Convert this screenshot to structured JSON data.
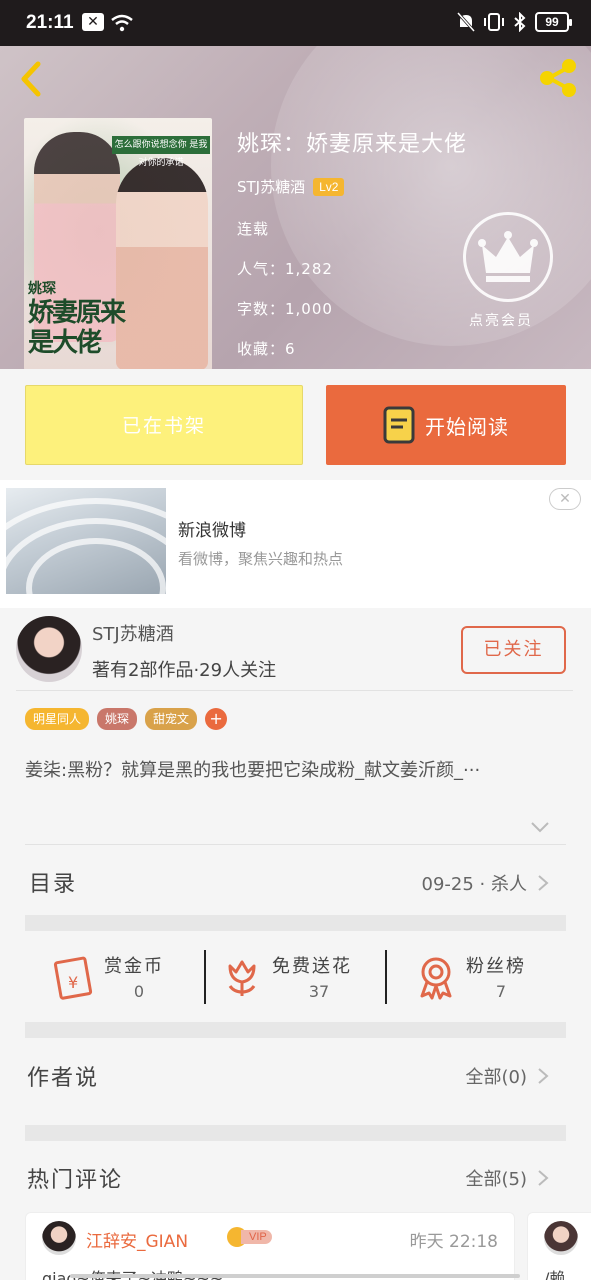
{
  "status_bar": {
    "time": "21:11",
    "battery": "99"
  },
  "book": {
    "title": "姚琛：娇妻原来是大佬",
    "author": "STJ苏糖酒",
    "level": "Lv2",
    "status": "连载",
    "popularity": "人气：1,282",
    "word_count": "字数：1,000",
    "favorites": "收藏：6",
    "vip_label": "点亮会员"
  },
  "cover": {
    "tag": "怎么跟你说想念你 是我对你的承诺",
    "title": "娇妻原来是大佬",
    "subtitle": "姚琛"
  },
  "actions": {
    "shelf": "已在书架",
    "read": "开始阅读"
  },
  "ad": {
    "title": "新浪微博",
    "subtitle": "看微博，聚焦兴趣和热点",
    "close": "✕"
  },
  "author": {
    "name": "STJ苏糖酒",
    "stats": "著有2部作品·29人关注",
    "follow": "已关注"
  },
  "tags": [
    {
      "label": "明星同人",
      "color": "#f5b630"
    },
    {
      "label": "姚琛",
      "color": "#c9776a"
    },
    {
      "label": "甜宠文",
      "color": "#d9a24a"
    }
  ],
  "description": "姜柒:黑粉？就算是黑的我也要把它染成粉_献文姜沂颜_···",
  "toc": {
    "label": "目录",
    "latest": "09-25 · 杀人"
  },
  "stats": [
    {
      "label": "赏金币",
      "value": "0",
      "icon": "red-envelope-icon"
    },
    {
      "label": "免费送花",
      "value": "37",
      "icon": "flower-icon"
    },
    {
      "label": "粉丝榜",
      "value": "7",
      "icon": "medal-icon"
    }
  ],
  "author_says": {
    "label": "作者说",
    "all": "全部(0)"
  },
  "hot_comments": {
    "label": "热门评论",
    "all": "全部(5)"
  },
  "comments": [
    {
      "name": "江辞安_GIAN",
      "vip": "VIP",
      "time": "昨天 22:18",
      "text": "giao~俺来了~冲鸭~~~"
    },
    {
      "text": "/赖"
    }
  ],
  "colors": {
    "accent": "#ea6a3e",
    "shelf": "#fdf17c",
    "badge": "#f5b630"
  }
}
